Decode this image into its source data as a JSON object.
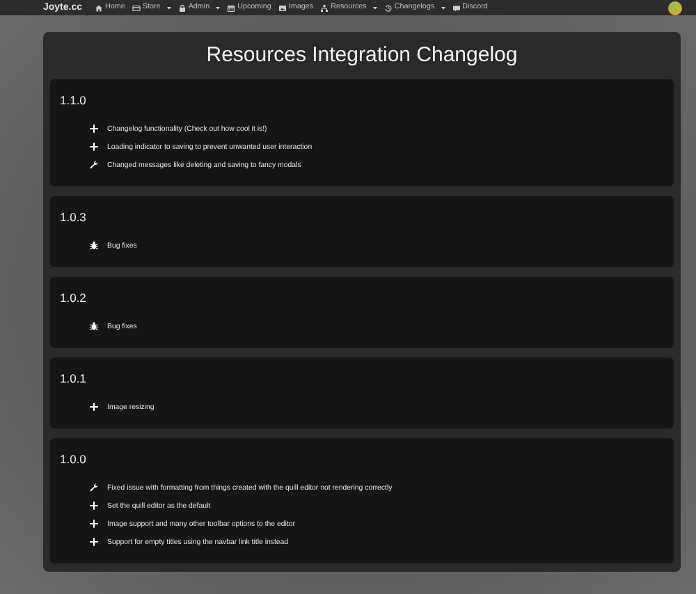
{
  "navbar": {
    "brand": "Joyte.cc",
    "items": [
      {
        "label": "Home",
        "kind": "home",
        "dropdown": false
      },
      {
        "label": "Store",
        "kind": "card",
        "dropdown": true
      },
      {
        "label": "Admin",
        "kind": "lock",
        "dropdown": true
      },
      {
        "label": "Upcoming",
        "kind": "calendar",
        "dropdown": false
      },
      {
        "label": "Images",
        "kind": "image",
        "dropdown": false
      },
      {
        "label": "Resources",
        "kind": "sitemap",
        "dropdown": true
      },
      {
        "label": "Changelogs",
        "kind": "history",
        "dropdown": true
      },
      {
        "label": "Discord",
        "kind": "chat",
        "dropdown": false
      }
    ]
  },
  "page": {
    "title": "Resources Integration Changelog",
    "versions": [
      {
        "version": "1.1.0",
        "changes": [
          {
            "kind": "add",
            "text": "Changelog functionality (Check out how cool it is!)"
          },
          {
            "kind": "add",
            "text": "Loading indicator to saving to prevent unwanted user interaction"
          },
          {
            "kind": "fix",
            "text": "Changed messages like deleting and saving to fancy modals"
          }
        ]
      },
      {
        "version": "1.0.3",
        "changes": [
          {
            "kind": "bug",
            "text": "Bug fixes"
          }
        ]
      },
      {
        "version": "1.0.2",
        "changes": [
          {
            "kind": "bug",
            "text": "Bug fixes"
          }
        ]
      },
      {
        "version": "1.0.1",
        "changes": [
          {
            "kind": "add",
            "text": "Image resizing"
          }
        ]
      },
      {
        "version": "1.0.0",
        "changes": [
          {
            "kind": "fix",
            "text": "Fixed issue with formatting from things created with the quill editor not rendering correctly"
          },
          {
            "kind": "add",
            "text": "Set the quill editor as the default"
          },
          {
            "kind": "add",
            "text": "Image support and many other toolbar options to the editor"
          },
          {
            "kind": "add",
            "text": "Support for empty titles using the navbar link title instead"
          }
        ]
      }
    ]
  }
}
